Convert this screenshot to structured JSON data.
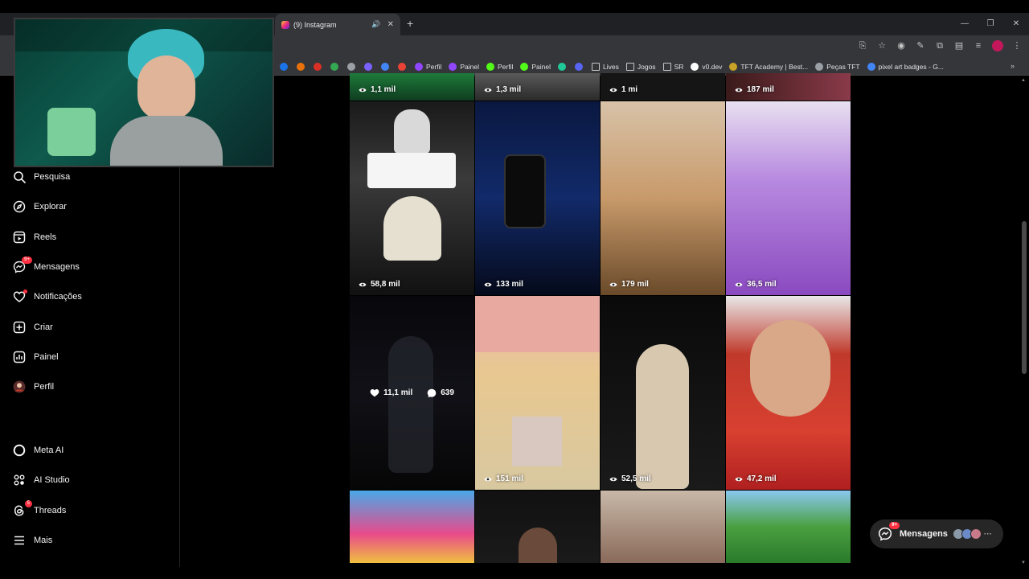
{
  "browser": {
    "tab_title": "(9) Instagram",
    "new_tab": "+",
    "bookmarks": [
      {
        "label": "",
        "color": "#1a73e8"
      },
      {
        "label": "",
        "color": "#e8710a"
      },
      {
        "label": "",
        "color": "#d93025"
      },
      {
        "label": "",
        "color": "#34a853"
      },
      {
        "label": "",
        "color": "#9aa0a6"
      },
      {
        "label": "",
        "color": "#7b61ff"
      },
      {
        "label": "",
        "color": "#4285f4"
      },
      {
        "label": "",
        "color": "#ea4335"
      },
      {
        "label": "Perfil",
        "color": "#9146ff"
      },
      {
        "label": "Painel",
        "color": "#9146ff"
      },
      {
        "label": "Perfil",
        "color": "#53fc18"
      },
      {
        "label": "Painel",
        "color": "#53fc18"
      },
      {
        "label": "",
        "color": "#20c997"
      },
      {
        "label": "",
        "color": "#5865f2"
      },
      {
        "label": "Lives",
        "color": "folder"
      },
      {
        "label": "Jogos",
        "color": "folder"
      },
      {
        "label": "SR",
        "color": "folder"
      },
      {
        "label": "v0.dev",
        "color": "#ffffff"
      },
      {
        "label": "TFT Academy | Best...",
        "color": "#c9a227"
      },
      {
        "label": "Peças TFT",
        "color": "#9aa0a6"
      },
      {
        "label": "pixel art badges - G...",
        "color": "#4285f4"
      }
    ]
  },
  "sidebar": {
    "search": "Pesquisa",
    "explore": "Explorar",
    "reels": "Reels",
    "messages": "Mensagens",
    "messages_badge": "9+",
    "notifications": "Notificações",
    "create": "Criar",
    "dashboard": "Painel",
    "profile": "Perfil",
    "meta_ai": "Meta AI",
    "ai_studio": "AI Studio",
    "threads": "Threads",
    "threads_badge": "5",
    "more": "Mais"
  },
  "grid": {
    "row0": [
      "1,1 mil",
      "1,3 mil",
      "1 mi",
      "187 mil"
    ],
    "row1": [
      "58,8 mil",
      "133 mil",
      "179 mil",
      "36,5 mil"
    ],
    "row2_hover": {
      "likes": "11,1 mil",
      "comments": "639"
    },
    "row2": [
      "",
      "151 mil",
      "52,5 mil",
      "47,2 mil"
    ],
    "colors": {
      "accent_pink": "#ff3040"
    }
  },
  "messages_pill": {
    "label": "Mensagens",
    "badge": "9+"
  }
}
